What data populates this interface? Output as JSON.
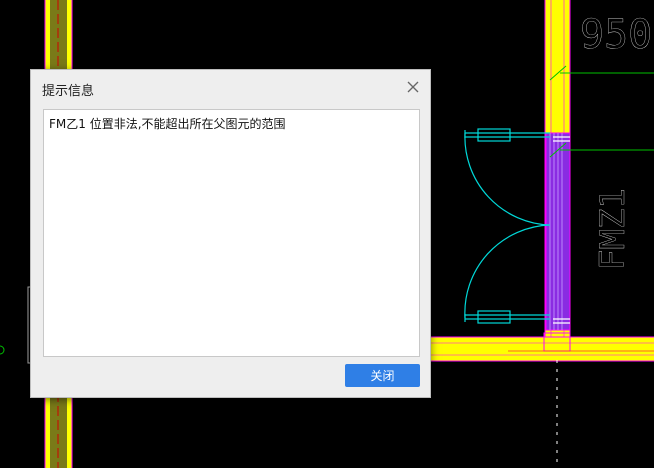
{
  "cad": {
    "dimension_text": "950",
    "door_label": "FMZ1",
    "colors": {
      "background": "#000000",
      "wall_fill": "#ffff00",
      "wall_edge": "#ff00ff",
      "door_fill": "#8a2be2",
      "door_swing": "#00d8d8",
      "axis_line": "#00c000",
      "text": "#ffffff"
    }
  },
  "dialog": {
    "title": "提示信息",
    "message": "FM乙1 位置非法,不能超出所在父图元的范围",
    "close_button_label": "关闭",
    "close_icon": "close-icon",
    "colors": {
      "button": "#2f7fe6",
      "panel": "#eeeeee"
    }
  }
}
